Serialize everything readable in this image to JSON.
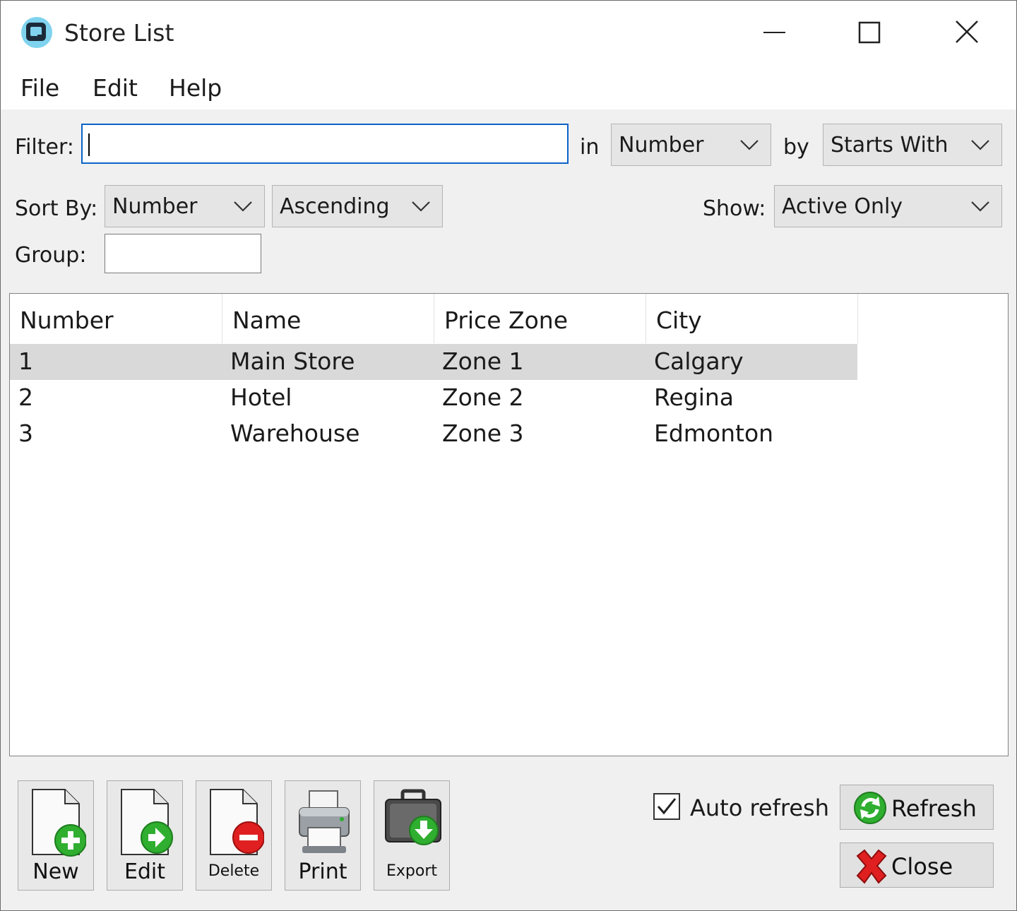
{
  "window": {
    "title": "Store List"
  },
  "menu": [
    "File",
    "Edit",
    "Help"
  ],
  "filter": {
    "label": "Filter:",
    "value": "",
    "in_label": "in",
    "field": "Number",
    "by_label": "by",
    "match": "Starts With"
  },
  "sort": {
    "label": "Sort By:",
    "field": "Number",
    "direction": "Ascending"
  },
  "show": {
    "label": "Show:",
    "value": "Active Only"
  },
  "group": {
    "label": "Group:",
    "value": ""
  },
  "table": {
    "columns": [
      "Number",
      "Name",
      "Price Zone",
      "City"
    ],
    "rows": [
      {
        "number": "1",
        "name": "Main Store",
        "price_zone": "Zone 1",
        "city": "Calgary",
        "selected": true
      },
      {
        "number": "2",
        "name": "Hotel",
        "price_zone": "Zone 2",
        "city": "Regina",
        "selected": false
      },
      {
        "number": "3",
        "name": "Warehouse",
        "price_zone": "Zone 3",
        "city": "Edmonton",
        "selected": false
      }
    ]
  },
  "toolbar": {
    "new": "New",
    "edit": "Edit",
    "delete": "Delete",
    "print": "Print",
    "export": "Export"
  },
  "auto_refresh": {
    "label": "Auto refresh",
    "checked": true
  },
  "actions": {
    "refresh": "Refresh",
    "close": "Close"
  },
  "colors": {
    "accent": "#0a63c7",
    "selected_row": "#d9d9d9",
    "add_green": "#2fae2f",
    "delete_red": "#e02020"
  }
}
